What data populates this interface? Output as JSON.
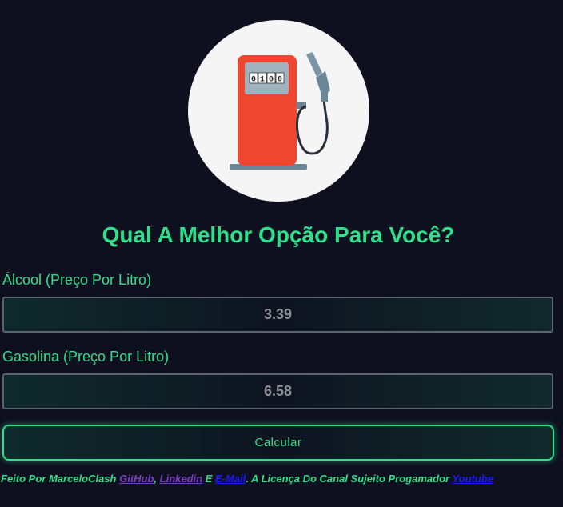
{
  "logo": {
    "icon": "fuel-pump-icon",
    "pump_display": [
      "0",
      "1",
      "0",
      "0"
    ],
    "colors": {
      "circle": "#f5f5f5",
      "pump_body": "#ef4632",
      "pump_base": "#6b8797",
      "display": "#9fb2be"
    }
  },
  "header": {
    "title": "Qual A Melhor Opção Para Você?"
  },
  "form": {
    "alcool_label": "Álcool (Preço Por Litro)",
    "alcool_value": "3.39",
    "gasolina_label": "Gasolina (Preço Por Litro)",
    "gasolina_value": "6.58",
    "calcular_label": "Calcular"
  },
  "footer": {
    "prefix": "Feito Por MarceloClash ",
    "github": "GitHub",
    "sep1": ", ",
    "linkedin": "Linkedin",
    "sep2": " E ",
    "email": "E-Mail",
    "middle": ". A Licença Do Canal Sujeito Progamador ",
    "youtube": "Youtube"
  },
  "theme": {
    "background": "#0e0f1f",
    "accent": "#2ee08a"
  }
}
